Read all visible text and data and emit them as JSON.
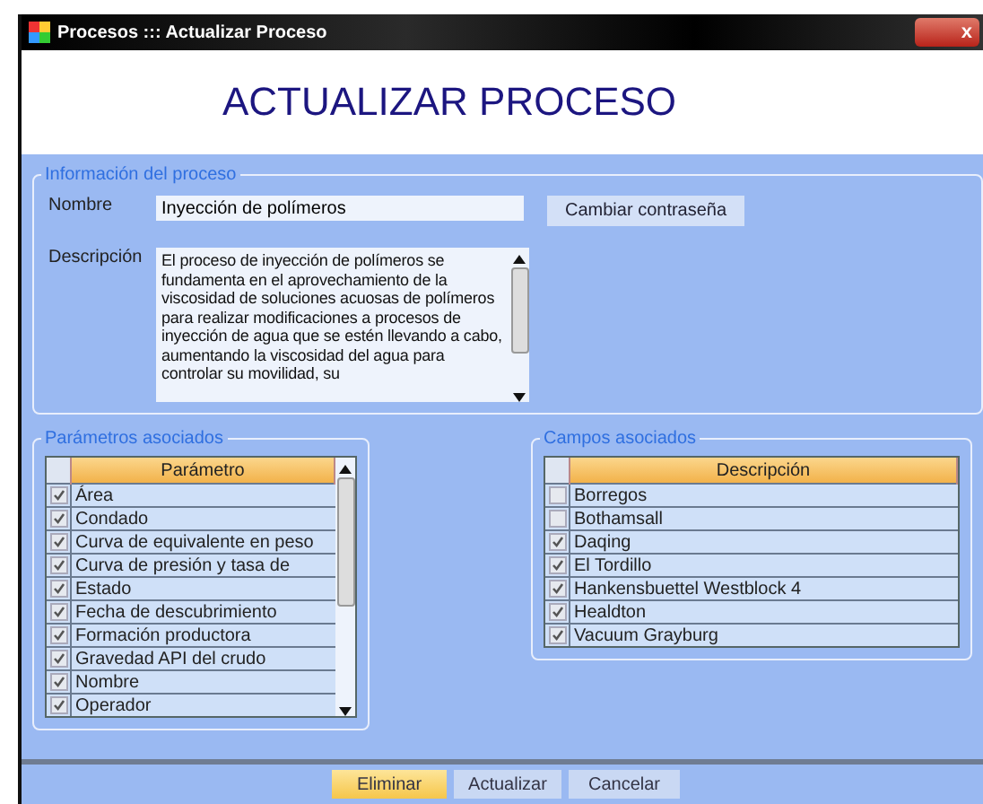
{
  "window": {
    "title": "Procesos ::: Actualizar Proceso",
    "close": "x"
  },
  "heading": "ACTUALIZAR PROCESO",
  "info": {
    "legend": "Información del proceso",
    "name_label": "Nombre",
    "name_value": "Inyección de polímeros",
    "change_button": "Cambiar contraseña",
    "description_label": "Descripción",
    "description_value": "El proceso de inyección de polímeros se fundamenta en el aprovechamiento de la viscosidad de soluciones acuosas de polímeros para  realizar modificaciones a procesos de inyección de agua que se estén llevando a cabo, aumentando la viscosidad del agua para controlar su movilidad, su"
  },
  "parameters": {
    "legend": "Parámetros asociados",
    "column": "Parámetro",
    "rows": [
      {
        "label": "Área",
        "checked": true
      },
      {
        "label": "Condado",
        "checked": true
      },
      {
        "label": "Curva de equivalente en peso",
        "checked": true
      },
      {
        "label": "Curva de presión y tasa de",
        "checked": true
      },
      {
        "label": "Estado",
        "checked": true
      },
      {
        "label": "Fecha de descubrimiento",
        "checked": true
      },
      {
        "label": "Formación productora",
        "checked": true
      },
      {
        "label": "Gravedad API del crudo",
        "checked": true
      },
      {
        "label": "Nombre",
        "checked": true
      },
      {
        "label": "Operador",
        "checked": true
      }
    ]
  },
  "fields": {
    "legend": "Campos asociados",
    "column": "Descripción",
    "rows": [
      {
        "label": "Borregos",
        "checked": false
      },
      {
        "label": "Bothamsall",
        "checked": false
      },
      {
        "label": "Daqing",
        "checked": true
      },
      {
        "label": "El Tordillo",
        "checked": true
      },
      {
        "label": "Hankensbuettel Westblock 4",
        "checked": true
      },
      {
        "label": "Healdton",
        "checked": true
      },
      {
        "label": "Vacuum Grayburg",
        "checked": true
      }
    ]
  },
  "buttons": [
    {
      "label": "Eliminar",
      "selected": true
    },
    {
      "label": "Actualizar",
      "selected": false
    },
    {
      "label": "Cancelar",
      "selected": false
    }
  ]
}
